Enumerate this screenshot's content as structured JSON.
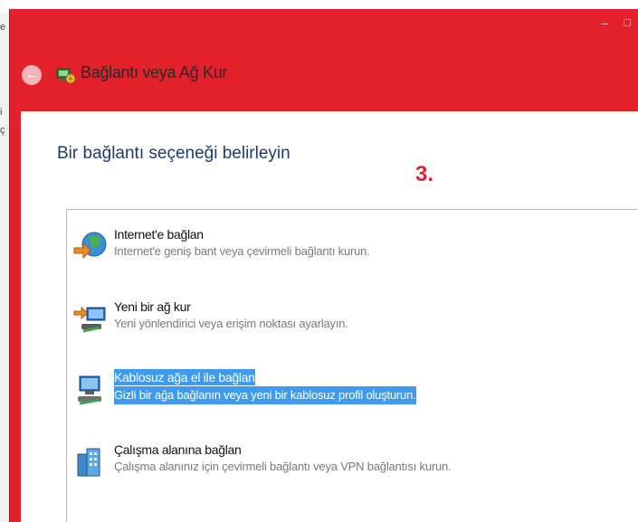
{
  "window": {
    "title": "Bağlantı veya Ağ Kur",
    "controls": {
      "minimize": "–",
      "maximize": "□"
    },
    "back_icon": "back-arrow-icon",
    "accent": "#e3212b"
  },
  "background_text": [
    "e",
    "i",
    "ç"
  ],
  "content": {
    "heading": "Bir bağlantı seçeneği belirleyin",
    "step_label": "3."
  },
  "options": [
    {
      "title": "Internet'e bağlan",
      "description": "Internet'e geniş bant veya çevirmeli bağlantı kurun.",
      "icon": "globe-connect-icon",
      "selected": false
    },
    {
      "title": "Yeni bir ağ kur",
      "description": "Yeni yönlendirici veya erişim noktası ayarlayın.",
      "icon": "network-router-icon",
      "selected": false
    },
    {
      "title": "Kablosuz ağa el ile bağlan",
      "description": "Gizli bir ağa bağlanın veya yeni bir kablosuz profil oluşturun.",
      "icon": "wireless-computer-icon",
      "selected": true
    },
    {
      "title": "Çalışma alanına bağlan",
      "description": "Çalışma alanınız için çevirmeli bağlantı veya VPN bağlantısı kurun.",
      "icon": "workplace-vpn-icon",
      "selected": false
    }
  ],
  "colors": {
    "selection": "#3e9bf0",
    "heading": "#1e3a6e",
    "step_label": "#d9262e"
  }
}
